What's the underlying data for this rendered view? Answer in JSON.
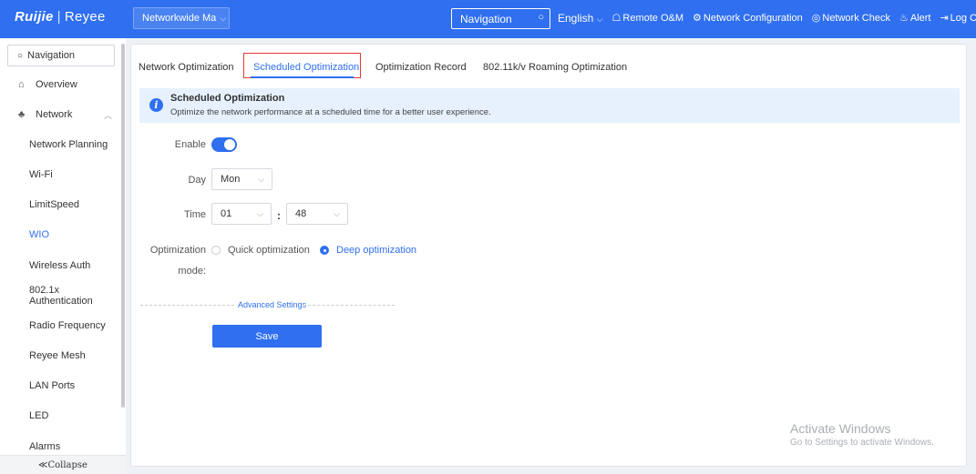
{
  "header": {
    "logo": "Ruijie",
    "logo_sep": "|",
    "logo_sub": "Reyee",
    "network_select": "Networkwide Ma",
    "nav_search": "Navigation",
    "language": "English",
    "links": [
      {
        "icon": "remote-icon",
        "label": "Remote O&M"
      },
      {
        "icon": "network-config-icon",
        "label": "Network Configuration"
      },
      {
        "icon": "network-check-icon",
        "label": "Network Check"
      },
      {
        "icon": "alert-icon",
        "label": "Alert"
      },
      {
        "icon": "logout-icon",
        "label": "Log Out"
      }
    ]
  },
  "sidebar": {
    "search_placeholder": "Navigation",
    "overview": "Overview",
    "network": "Network",
    "items": [
      "Network Planning",
      "Wi-Fi",
      "LimitSpeed",
      "WIO",
      "Wireless Auth",
      "802.1x Authentication",
      "Radio Frequency",
      "Reyee Mesh",
      "LAN Ports",
      "LED",
      "Alarms"
    ],
    "active_item": "WIO",
    "collapse": "≪Collapse"
  },
  "tabs": [
    "Network Optimization",
    "Scheduled Optimization",
    "Optimization Record",
    "802.11k/v Roaming Optimization"
  ],
  "active_tab": "Scheduled Optimization",
  "info": {
    "title": "Scheduled Optimization",
    "description": "Optimize the network performance at a scheduled time for a better user experience."
  },
  "form": {
    "enable_label": "Enable",
    "enabled": true,
    "day_label": "Day",
    "day_value": "Mon",
    "time_label": "Time",
    "hour_value": "01",
    "time_sep": ":",
    "minute_value": "48",
    "mode_label_1": "Optimization",
    "mode_label_2": "mode:",
    "mode_options": [
      "Quick optimization",
      "Deep optimization"
    ],
    "mode_selected": "Deep optimization",
    "advanced": "Advanced Settings",
    "save": "Save"
  },
  "watermark": {
    "line1": "Activate Windows",
    "line2": "Go to Settings to activate Windows."
  },
  "colors": {
    "primary": "#2f6ff0",
    "highlight_box": "#e53935",
    "info_bg": "#e6f1fd"
  }
}
